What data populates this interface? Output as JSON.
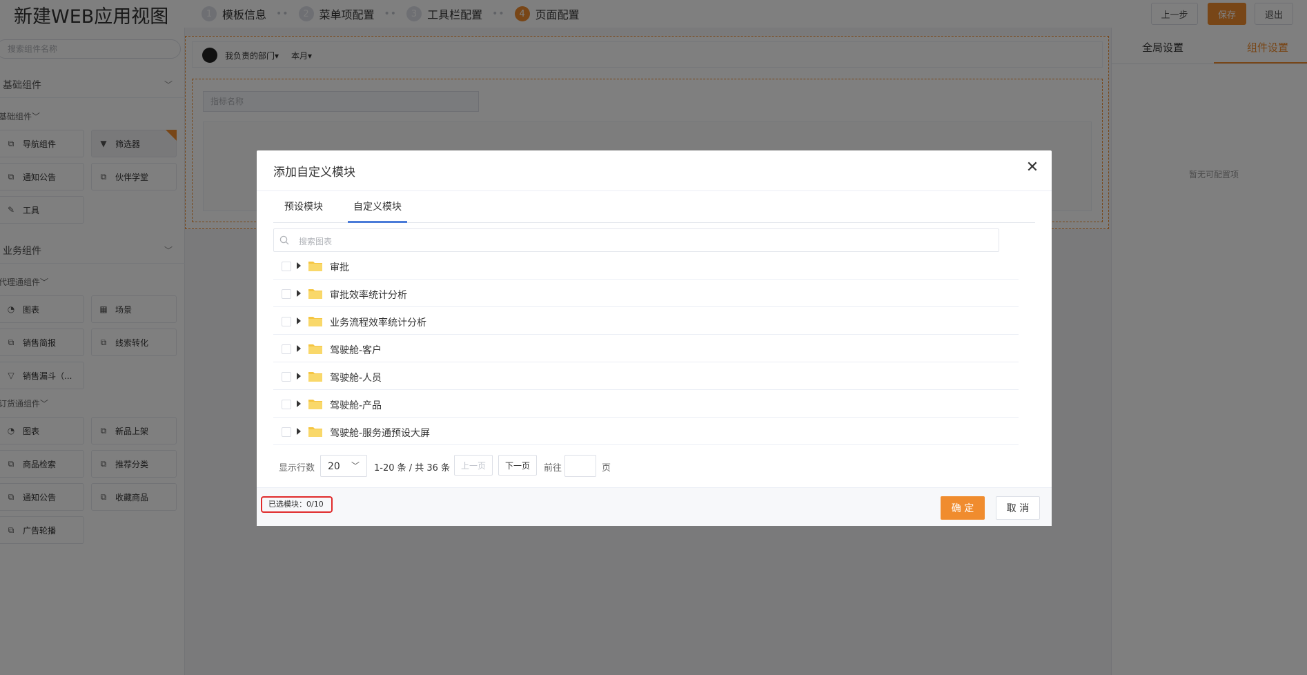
{
  "header": {
    "title": "新建WEB应用视图",
    "steps": [
      {
        "num": "1",
        "label": "模板信息"
      },
      {
        "num": "2",
        "label": "菜单项配置"
      },
      {
        "num": "3",
        "label": "工具栏配置"
      },
      {
        "num": "4",
        "label": "页面配置"
      }
    ],
    "prev_label": "上一步",
    "save_label": "保存",
    "exit_label": "退出"
  },
  "sidebar": {
    "search_placeholder": "搜索组件名称",
    "sections": [
      {
        "label": "基础组件"
      },
      {
        "label": "业务组件"
      }
    ],
    "groups": [
      {
        "label": "基础组件",
        "items": [
          "导航组件",
          "筛选器",
          "通知公告",
          "伙伴学堂",
          "工具"
        ]
      },
      {
        "label": "代理通组件",
        "items": [
          "图表",
          "场景",
          "销售简报",
          "线索转化",
          "销售漏斗（..."
        ]
      },
      {
        "label": "订货通组件",
        "items": [
          "图表",
          "新品上架",
          "商品检索",
          "推荐分类",
          "通知公告",
          "收藏商品",
          "广告轮播"
        ]
      }
    ]
  },
  "canvas": {
    "dept_filter": "我负责的部门",
    "period_filter": "本月",
    "metric_placeholder": "指标名称"
  },
  "right_panel": {
    "tab_global": "全局设置",
    "tab_component": "组件设置",
    "empty_text": "暂无可配置项"
  },
  "modal": {
    "title": "添加自定义模块",
    "tabs": [
      "预设模块",
      "自定义模块"
    ],
    "search_placeholder": "搜索图表",
    "rows": [
      "审批",
      "审批效率统计分析",
      "业务流程效率统计分析",
      "驾驶舱-客户",
      "驾驶舱-人员",
      "驾驶舱-产品",
      "驾驶舱-服务通预设大屏"
    ],
    "pager": {
      "rows_label": "显示行数",
      "page_size": "20",
      "range_text": "1-20 条 / 共 36 条",
      "prev": "上一页",
      "next": "下一页",
      "goto_label": "前往",
      "page_unit": "页"
    },
    "selected_text": "已选模块：0/10",
    "ok": "确 定",
    "cancel": "取 消"
  },
  "colors": {
    "accent": "#f08c2e",
    "tab_blue": "#4a7bd8",
    "highlight_red": "#e02a2a",
    "folder": "#f5c542"
  }
}
